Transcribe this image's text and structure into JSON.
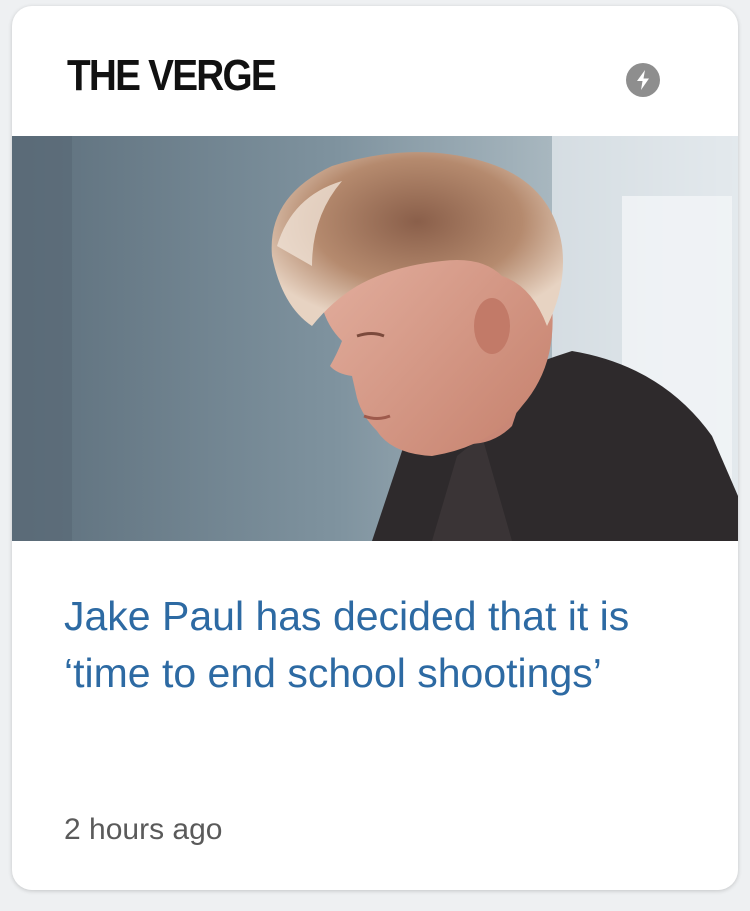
{
  "card": {
    "publisher": "THE VERGE",
    "amp_icon": "lightning-bolt-icon",
    "image_alt": "Jake Paul",
    "headline": "Jake Paul has decided that it is ‘time to end school shootings’",
    "timestamp": "2 hours ago"
  },
  "colors": {
    "headline": "#2d6aa3",
    "logo": "#111111",
    "amp_badge": "#8e8e8e",
    "timestamp": "#5a5a5a"
  }
}
